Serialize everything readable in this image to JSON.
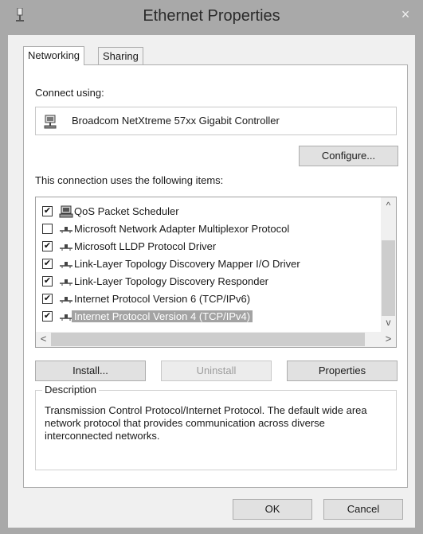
{
  "window": {
    "title": "Ethernet Properties",
    "close_symbol": "×"
  },
  "tabs": [
    {
      "label": "Networking",
      "active": true
    },
    {
      "label": "Sharing",
      "active": false
    }
  ],
  "connect": {
    "label": "Connect using:",
    "adapter": "Broadcom NetXtreme 57xx Gigabit Controller",
    "adapter_icon": "network-adapter-icon",
    "configure_label": "Configure..."
  },
  "items_section": {
    "label": "This connection uses the following items:",
    "items": [
      {
        "label": "QoS Packet Scheduler",
        "checked": true,
        "icon": "scheduler-icon",
        "selected": false
      },
      {
        "label": "Microsoft Network Adapter Multiplexor Protocol",
        "checked": false,
        "icon": "protocol-icon",
        "selected": false
      },
      {
        "label": "Microsoft LLDP Protocol Driver",
        "checked": true,
        "icon": "protocol-icon",
        "selected": false
      },
      {
        "label": "Link-Layer Topology Discovery Mapper I/O Driver",
        "checked": true,
        "icon": "protocol-icon",
        "selected": false
      },
      {
        "label": "Link-Layer Topology Discovery Responder",
        "checked": true,
        "icon": "protocol-icon",
        "selected": false
      },
      {
        "label": "Internet Protocol Version 6 (TCP/IPv6)",
        "checked": true,
        "icon": "protocol-icon",
        "selected": false
      },
      {
        "label": "Internet Protocol Version 4 (TCP/IPv4)",
        "checked": true,
        "icon": "protocol-icon",
        "selected": true
      }
    ],
    "scroll_up": "^",
    "scroll_down": "v",
    "scroll_left": "<",
    "scroll_right": ">"
  },
  "actions": {
    "install": "Install...",
    "uninstall": "Uninstall",
    "properties": "Properties"
  },
  "description": {
    "legend": "Description",
    "text": "Transmission Control Protocol/Internet Protocol. The default wide area network protocol that provides communication across diverse interconnected networks."
  },
  "footer": {
    "ok": "OK",
    "cancel": "Cancel"
  },
  "colors": {
    "titlebar": "#a9a9a9",
    "selection": "#a3a3a3"
  }
}
